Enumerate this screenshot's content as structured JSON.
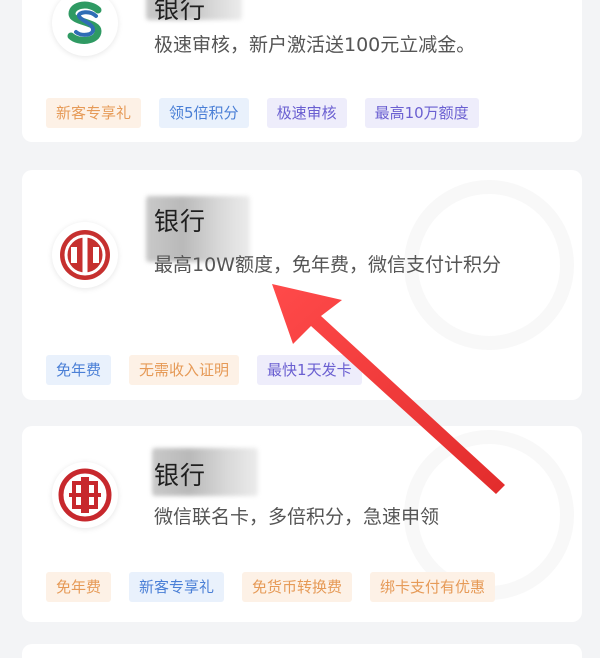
{
  "cards": [
    {
      "logo_icon": "shanghai-bank-logo-icon",
      "title": "银行",
      "description": "极速审核，新户激活送100元立减金。",
      "tags": [
        {
          "label": "新客专享礼",
          "tone": "orange"
        },
        {
          "label": "领5倍积分",
          "tone": "blue"
        },
        {
          "label": "极速审核",
          "tone": "purple"
        },
        {
          "label": "最高10万额度",
          "tone": "purple"
        }
      ]
    },
    {
      "logo_icon": "citic-bank-logo-icon",
      "title": "银行",
      "description": "最高10W额度，免年费，微信支付计积分",
      "tags": [
        {
          "label": "免年费",
          "tone": "blue"
        },
        {
          "label": "无需收入证明",
          "tone": "orange"
        },
        {
          "label": "最快1天发卡",
          "tone": "purple"
        }
      ]
    },
    {
      "logo_icon": "icbc-logo-icon",
      "title": "银行",
      "description": "微信联名卡，多倍积分，急速申领",
      "tags": [
        {
          "label": "免年费",
          "tone": "orange"
        },
        {
          "label": "新客专享礼",
          "tone": "blue"
        },
        {
          "label": "免货币转换费",
          "tone": "orange"
        },
        {
          "label": "绑卡支付有优惠",
          "tone": "orange"
        }
      ]
    }
  ],
  "colors": {
    "page_bg": "#f3f4f6",
    "arrow": "#ee3b3b",
    "shanghai_green": "#2f9a63",
    "shanghai_blue": "#2f6db5",
    "citic_red": "#c6302f",
    "icbc_red": "#c7282d"
  }
}
